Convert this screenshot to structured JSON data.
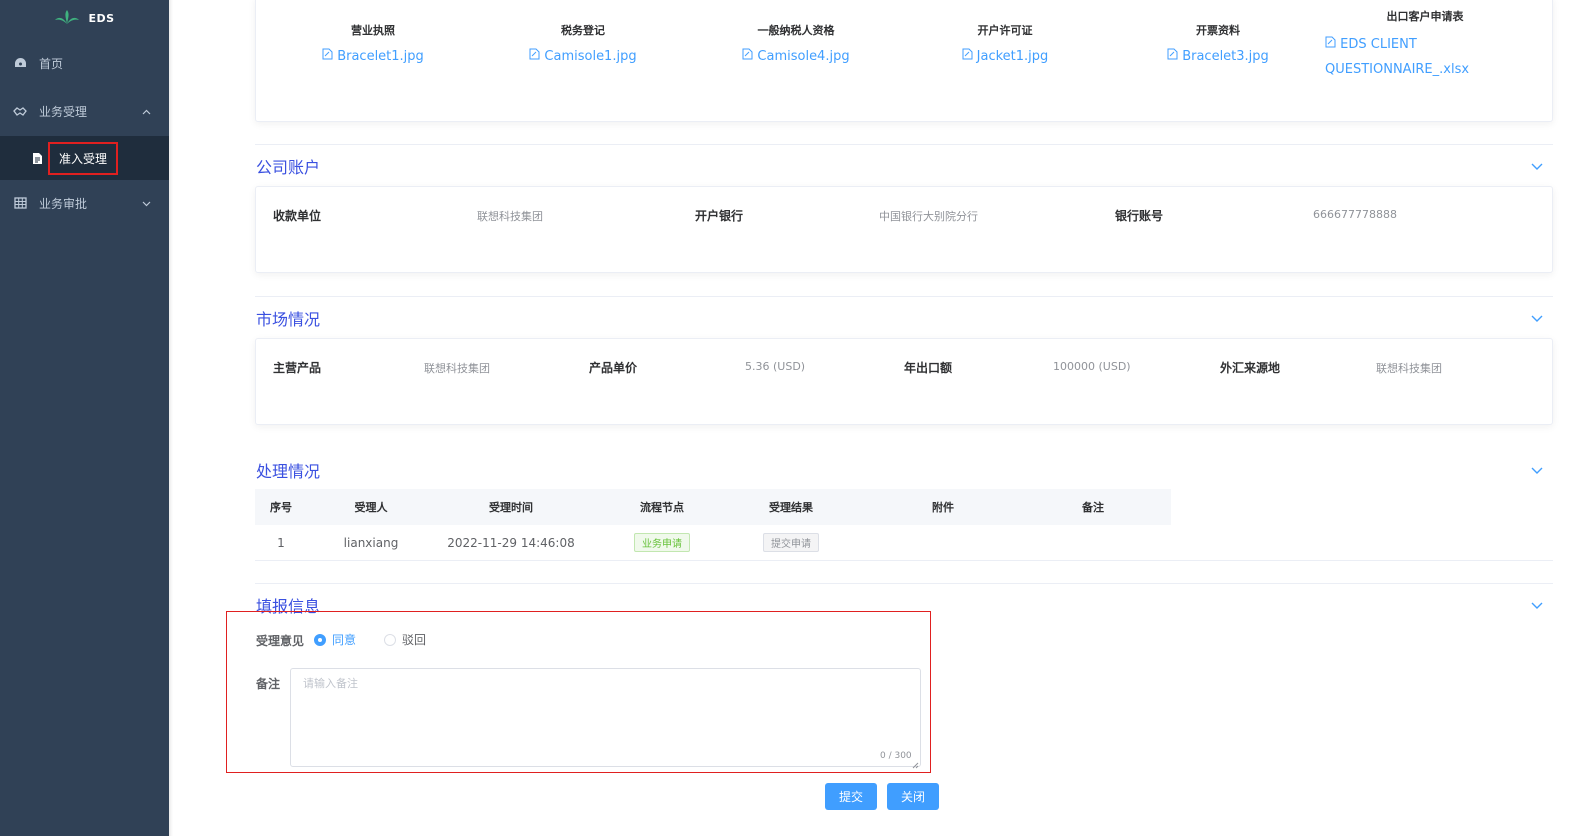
{
  "sidebar": {
    "brand": "EDS",
    "items": [
      {
        "label": "首页"
      },
      {
        "label": "业务受理"
      },
      {
        "label": "业务审批"
      }
    ],
    "subitem": {
      "label": "准入受理"
    }
  },
  "documents": {
    "columns": [
      {
        "title": "营业执照",
        "file": "Bracelet1.jpg"
      },
      {
        "title": "税务登记",
        "file": "Camisole1.jpg"
      },
      {
        "title": "一般纳税人资格",
        "file": "Camisole4.jpg"
      },
      {
        "title": "开户许可证",
        "file": "Jacket1.jpg"
      },
      {
        "title": "开票资料",
        "file": "Bracelet3.jpg"
      },
      {
        "title": "出口客户申请表",
        "file_line1": "EDS CLIENT",
        "file_line2": "QUESTIONNAIRE_.xlsx"
      }
    ]
  },
  "account": {
    "title": "公司账户",
    "payee_label": "收款单位",
    "payee_value": "联想科技集团",
    "bank_label": "开户银行",
    "bank_value": "中国银行大别院分行",
    "account_label": "银行账号",
    "account_value": "666677778888"
  },
  "market": {
    "title": "市场情况",
    "product_label": "主营产品",
    "product_value": "联想科技集团",
    "price_label": "产品单价",
    "price_value": "5.36 (USD)",
    "export_label": "年出口额",
    "export_value": "100000 (USD)",
    "source_label": "外汇来源地",
    "source_value": "联想科技集团"
  },
  "process": {
    "title": "处理情况",
    "headers": [
      "序号",
      "受理人",
      "受理时间",
      "流程节点",
      "受理结果",
      "附件",
      "备注"
    ],
    "rows": [
      {
        "index": "1",
        "handler": "lianxiang",
        "time": "2022-11-29 14:46:08",
        "node": "业务申请",
        "result": "提交申请",
        "attachment": "",
        "remark": ""
      }
    ]
  },
  "fill": {
    "title": "填报信息",
    "opinion_label": "受理意见",
    "option_agree": "同意",
    "option_reject": "驳回",
    "selected": "同意",
    "remark_label": "备注",
    "remark_placeholder": "请输入备注",
    "remark_value": "",
    "counter": "0 / 300"
  },
  "buttons": {
    "submit": "提交",
    "close": "关闭"
  },
  "colors": {
    "sidebar_bg": "#304156",
    "accent": "#409eff",
    "highlight": "#e02020"
  }
}
